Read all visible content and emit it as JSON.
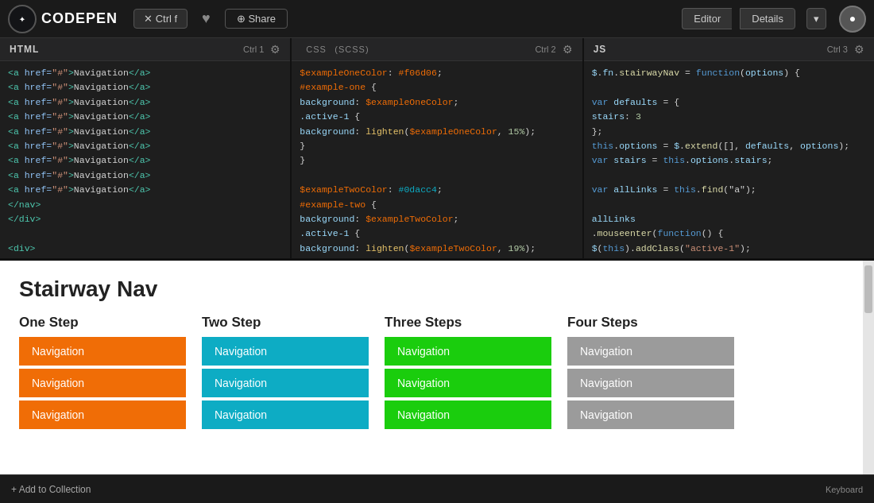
{
  "header": {
    "logo_text": "CODEPEN",
    "ctrl_f_label": "✕ Ctrl f",
    "heart_icon": "♥",
    "share_label": "⊕ Share",
    "editor_label": "Editor",
    "details_label": "Details",
    "chevron": "▾"
  },
  "editors": {
    "html": {
      "lang": "HTML",
      "ctrl": "Ctrl 1"
    },
    "css": {
      "lang": "CSS",
      "lang_sub": "(SCSS)",
      "ctrl": "Ctrl 2"
    },
    "js": {
      "lang": "JS",
      "ctrl": "Ctrl 3"
    }
  },
  "preview": {
    "title": "Stairway Nav",
    "sections": [
      {
        "title": "One Step",
        "color": "orange",
        "items": [
          "Navigation",
          "Navigation",
          "Navigation"
        ]
      },
      {
        "title": "Two Step",
        "color": "cyan",
        "items": [
          "Navigation",
          "Navigation",
          "Navigation"
        ]
      },
      {
        "title": "Three Steps",
        "color": "green",
        "items": [
          "Navigation",
          "Navigation",
          "Navigation"
        ]
      },
      {
        "title": "Four Steps",
        "color": "gray",
        "items": [
          "Navigation",
          "Navigation",
          "Navigation"
        ]
      }
    ]
  },
  "bottom_bar": {
    "add_collection": "+ Add to Collection",
    "keyboard": "Keyboard"
  }
}
